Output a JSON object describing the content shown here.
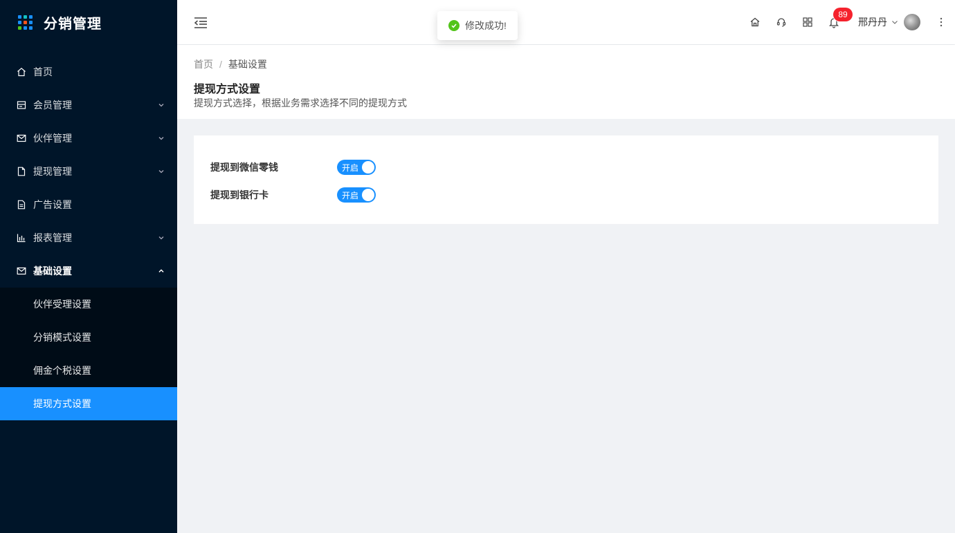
{
  "app": {
    "title": "分销管理"
  },
  "sidebar": {
    "items": [
      {
        "label": "首页",
        "icon": "home-icon",
        "has_arrow": false
      },
      {
        "label": "会员管理",
        "icon": "member-icon",
        "has_arrow": true
      },
      {
        "label": "伙伴管理",
        "icon": "mail-icon",
        "has_arrow": true
      },
      {
        "label": "提现管理",
        "icon": "file-icon",
        "has_arrow": true
      },
      {
        "label": "广告设置",
        "icon": "doc-icon",
        "has_arrow": false
      },
      {
        "label": "报表管理",
        "icon": "bar-chart-icon",
        "has_arrow": true
      },
      {
        "label": "基础设置",
        "icon": "mail-icon",
        "has_arrow": true,
        "open": true
      }
    ],
    "submenu": [
      {
        "label": "伙伴受理设置",
        "active": false
      },
      {
        "label": "分销模式设置",
        "active": false
      },
      {
        "label": "佣金个税设置",
        "active": false
      },
      {
        "label": "提现方式设置",
        "active": true
      }
    ]
  },
  "header": {
    "notification_count": "89",
    "user_name": "邢丹丹"
  },
  "toast": {
    "message": "修改成功!"
  },
  "breadcrumb": {
    "home": "首页",
    "separator": "/",
    "current": "基础设置"
  },
  "page": {
    "title": "提现方式设置",
    "description": "提现方式选择，根据业务需求选择不同的提现方式"
  },
  "form": {
    "rows": [
      {
        "label": "提现到微信零钱",
        "switch_text": "开启",
        "on": true
      },
      {
        "label": "提现到银行卡",
        "switch_text": "开启",
        "on": true
      }
    ]
  },
  "colors": {
    "sidebar_bg": "#001529",
    "submenu_bg": "#000c17",
    "primary": "#1890ff",
    "success": "#52c41a",
    "badge": "#f5222d"
  }
}
